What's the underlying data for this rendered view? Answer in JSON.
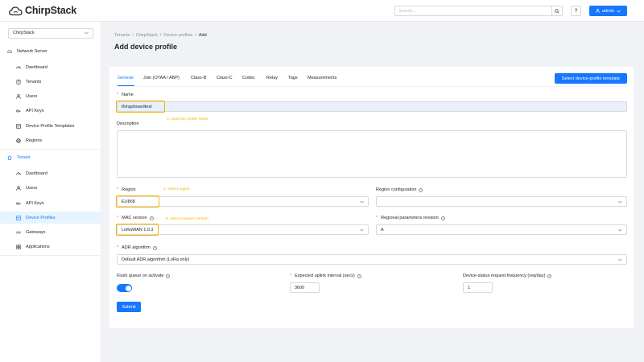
{
  "app": {
    "name": "ChirpStack",
    "brand_color": "#1677ff",
    "accent_annotation": "#f5b400"
  },
  "header": {
    "search_placeholder": "Search...",
    "help_label": "?",
    "user_label": "admin"
  },
  "sidebar": {
    "tenant_select": "ChirpStack",
    "network_server": {
      "label": "Network Server",
      "items": [
        {
          "label": "Dashboard",
          "icon": "dashboard-icon"
        },
        {
          "label": "Tenants",
          "icon": "tenants-icon"
        },
        {
          "label": "Users",
          "icon": "users-icon"
        },
        {
          "label": "API Keys",
          "icon": "key-icon"
        },
        {
          "label": "Device Profile Templates",
          "icon": "template-icon"
        },
        {
          "label": "Regions",
          "icon": "region-icon"
        }
      ]
    },
    "tenant": {
      "label": "Tenant",
      "items": [
        {
          "label": "Dashboard",
          "icon": "dashboard-icon"
        },
        {
          "label": "Users",
          "icon": "users-icon"
        },
        {
          "label": "API Keys",
          "icon": "key-icon"
        },
        {
          "label": "Device Profiles",
          "icon": "device-profile-icon",
          "active": true
        },
        {
          "label": "Gateways",
          "icon": "gateway-icon"
        },
        {
          "label": "Applications",
          "icon": "applications-icon"
        }
      ]
    }
  },
  "breadcrumb": [
    "Tenants",
    "ChirpStack",
    "Device profiles",
    "Add"
  ],
  "page_title": "Add device profile",
  "tabs": [
    "General",
    "Join (OTAA / ABP)",
    "Class-B",
    "Class-C",
    "Codec",
    "Relay",
    "Tags",
    "Measurements"
  ],
  "template_button": "Select device-profile template",
  "form": {
    "name": {
      "label": "Name",
      "value": "thingsboardtest",
      "annotation": "3. input the profile name"
    },
    "description": {
      "label": "Description",
      "value": ""
    },
    "region": {
      "label": "Region",
      "value": "EU868",
      "annotation": "4. select region"
    },
    "region_config": {
      "label": "Region configuration",
      "value": ""
    },
    "mac_version": {
      "label": "MAC version",
      "value": "LoRaWAN 1.0.3",
      "annotation": "5. select lorawan version"
    },
    "regional_params": {
      "label": "Regional parameters revision",
      "value": "A"
    },
    "adr": {
      "label": "ADR algorithm",
      "value": "Default ADR algorithm (LoRa only)"
    },
    "flush_queue": {
      "label": "Flush queue on activate",
      "enabled": true
    },
    "uplink_interval": {
      "label": "Expected uplink interval (secs)",
      "value": "3600"
    },
    "status_freq": {
      "label": "Device-status request frequency (req/day)",
      "value": "1"
    },
    "submit": "Submit"
  }
}
